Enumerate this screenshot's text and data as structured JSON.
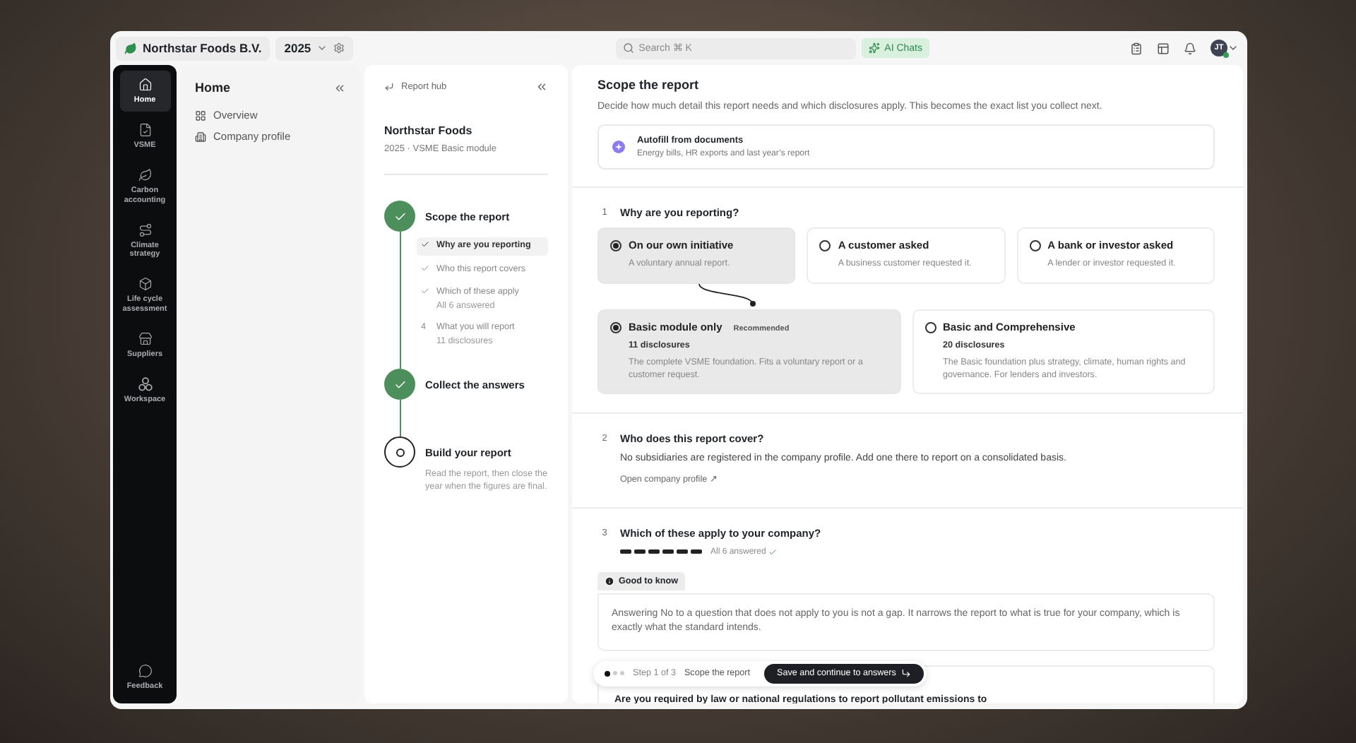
{
  "topbar": {
    "org": "Northstar Foods B.V.",
    "year": "2025",
    "search": {
      "placeholder": "Search ⌘ K"
    },
    "ai_button": "AI Chats",
    "avatar": "JT",
    "online": true
  },
  "nav": {
    "items": [
      {
        "label": "Home",
        "selected": true
      },
      {
        "label": "VSME",
        "selected": false
      },
      {
        "label": "Carbon accounting",
        "selected": false
      },
      {
        "label": "Climate strategy",
        "selected": false
      },
      {
        "label": "Life cycle assessment",
        "selected": false
      },
      {
        "label": "Suppliers",
        "selected": false
      },
      {
        "label": "Workspace",
        "selected": false
      }
    ],
    "footer": "Feedback"
  },
  "home_panel": {
    "title": "Home",
    "items": [
      "Overview",
      "Company profile"
    ]
  },
  "steps_panel": {
    "back": "Report hub",
    "company": "Northstar Foods",
    "subtitle": "2025 · VSME Basic module",
    "steps": [
      {
        "title": "Scope the report",
        "done": true,
        "substeps": [
          {
            "kind": "done",
            "label": "Why are you reporting",
            "selected": true
          },
          {
            "kind": "done",
            "label": "Who this report covers",
            "selected": false
          },
          {
            "kind": "done",
            "label": "Which of these apply",
            "note": "All 6 answered",
            "selected": false
          },
          {
            "kind": "numbered",
            "number": "4",
            "label": "What you will report",
            "note": "11 disclosures",
            "selected": false
          }
        ]
      },
      {
        "title": "Collect the answers",
        "done": true
      },
      {
        "title": "Build your report",
        "done": false,
        "description": "Read the report, then close the year when the figures are final."
      }
    ]
  },
  "main": {
    "title": "Scope the report",
    "description": "Decide how much detail this report needs and which disclosures apply. This becomes the exact list you collect next.",
    "autofill": {
      "title": "Autofill from documents",
      "subtitle": "Energy bills, HR exports and last year’s report"
    },
    "questions": [
      {
        "kind": "choice",
        "number": "1",
        "title": "Why are you reporting?",
        "groups": [
          [
            {
              "title": "On our own initiative",
              "description": "A voluntary annual report.",
              "selected": true
            },
            {
              "title": "A customer asked",
              "description": "A business customer requested it.",
              "selected": false
            },
            {
              "title": "A bank or investor asked",
              "description": "A lender or investor requested it.",
              "selected": false
            }
          ],
          [
            {
              "title": "Basic module only",
              "badge": "Recommended",
              "count": "11 disclosures",
              "description": "The complete VSME foundation. Fits a voluntary report or a customer request.",
              "selected": true
            },
            {
              "title": "Basic and Comprehensive",
              "count": "20 disclosures",
              "description": "The Basic foundation plus strategy, climate, human rights and governance. For lenders and investors.",
              "selected": false
            }
          ]
        ]
      },
      {
        "kind": "info",
        "number": "2",
        "title": "Who does this report cover?",
        "text": "No subsidiaries are registered in the company profile. Add one there to report on a consolidated basis.",
        "link": "Open company profile ↗"
      },
      {
        "kind": "checklist",
        "number": "3",
        "title": "Which of these apply to your company?",
        "segments": [
          {
            "answered": true
          },
          {
            "answered": true
          },
          {
            "answered": true
          },
          {
            "answered": true
          },
          {
            "answered": true
          },
          {
            "answered": true
          }
        ],
        "progress_label": "All 6 answered",
        "callout": {
          "label": "Good to know",
          "text": "Answering No to a question that does not apply to you is not a gap. It narrows the report to what is true for your company, which is exactly what the standard intends."
        },
        "items": [
          "Are you required by law or national regulations to report pollutant emissions to"
        ]
      }
    ]
  },
  "bottom_bar": {
    "dots": [
      {
        "selected": true
      },
      {
        "selected": false
      },
      {
        "selected": false
      }
    ],
    "step": "Step 1 of 3",
    "title": "Scope the report",
    "button": "Save and continue to answers"
  }
}
